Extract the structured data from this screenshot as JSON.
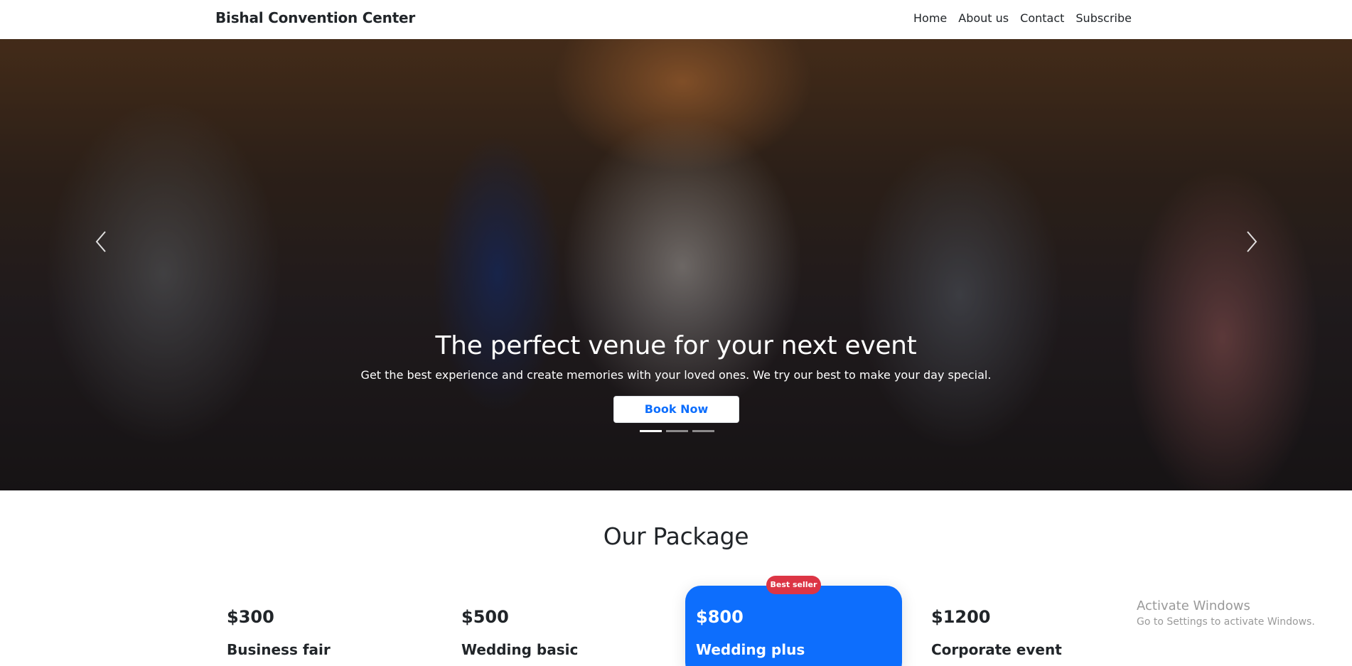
{
  "navbar": {
    "brand": "Bishal Convention Center",
    "links": [
      "Home",
      "About us",
      "Contact",
      "Subscribe"
    ]
  },
  "hero": {
    "title": "The perfect venue for your next event",
    "subtitle": "Get the best experience and create memories with your loved ones. We try our best to make your day special.",
    "button_label": "Book Now",
    "slide_count": 3,
    "active_slide": 1
  },
  "packages": {
    "title": "Our Package",
    "badge": "Best seller",
    "items": [
      {
        "price": "$300",
        "name": "Business fair"
      },
      {
        "price": "$500",
        "name": "Wedding basic"
      },
      {
        "price": "$800",
        "name": "Wedding plus"
      },
      {
        "price": "$1200",
        "name": "Corporate event"
      }
    ]
  },
  "watermark": {
    "line1": "Activate Windows",
    "line2": "Go to Settings to activate Windows."
  },
  "colors": {
    "accent": "#0d6efd",
    "badge": "#dc3545"
  }
}
